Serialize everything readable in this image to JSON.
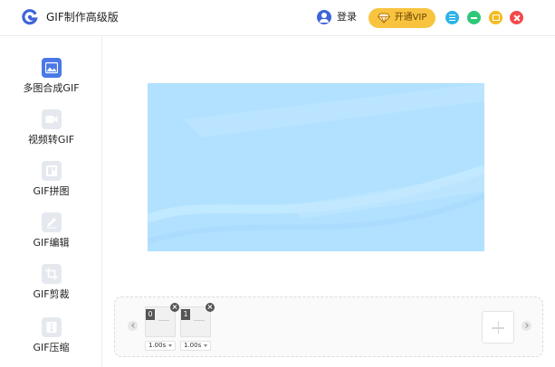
{
  "app": {
    "title": "GIF制作高级版",
    "brand_color": "#3f64d8"
  },
  "header": {
    "login_label": "登录",
    "vip_label": "开通VIP",
    "vip_color": "#f8c440",
    "window_controls": [
      "menu-icon",
      "minimize-icon",
      "maximize-icon",
      "close-icon"
    ]
  },
  "sidebar": {
    "items": [
      {
        "label": "多图合成GIF",
        "icon": "image-icon",
        "active": true
      },
      {
        "label": "视频转GIF",
        "icon": "video-icon",
        "active": false
      },
      {
        "label": "GIF拼图",
        "icon": "collage-icon",
        "active": false
      },
      {
        "label": "GIF编辑",
        "icon": "edit-icon",
        "active": false
      },
      {
        "label": "GIF剪裁",
        "icon": "crop-icon",
        "active": false
      },
      {
        "label": "GIF压缩",
        "icon": "compress-icon",
        "active": false
      }
    ]
  },
  "preview": {
    "background_color": "#b1e1ff"
  },
  "timeline": {
    "frames": [
      {
        "index": "0",
        "duration": "1.00s"
      },
      {
        "index": "1",
        "duration": "1.00s"
      }
    ]
  }
}
